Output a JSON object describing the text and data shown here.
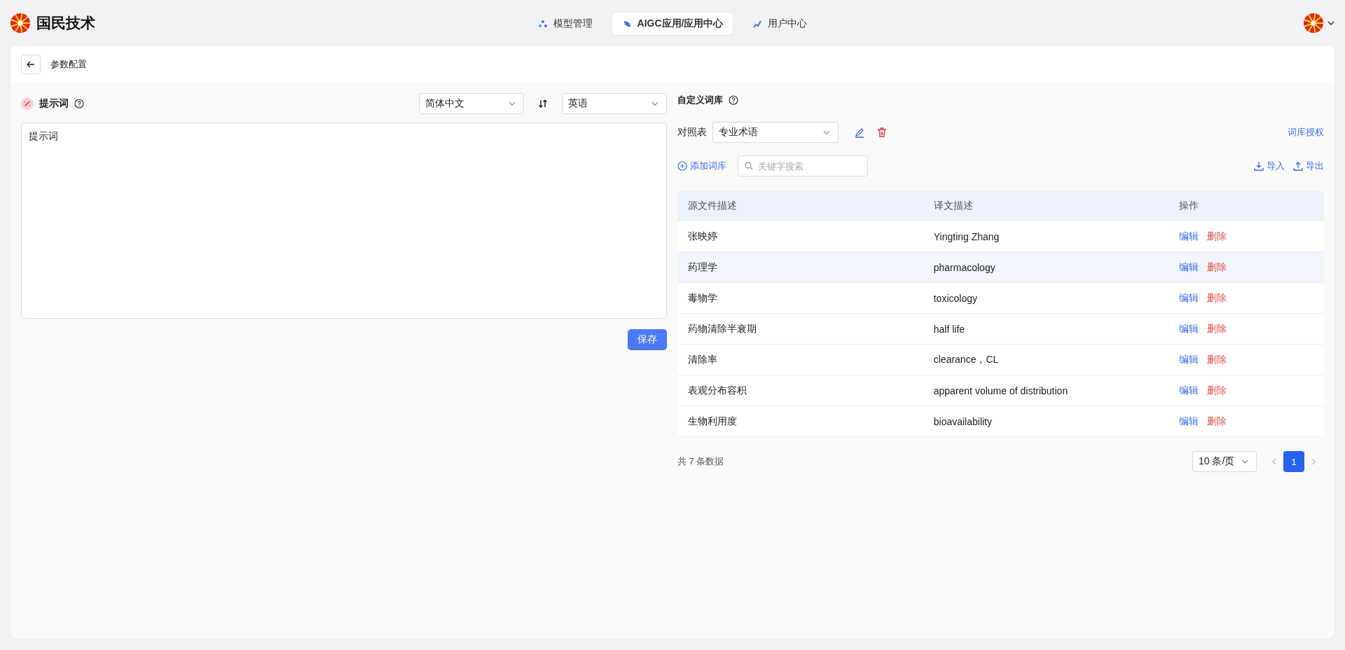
{
  "app": {
    "brand": "国民技术",
    "nav": [
      {
        "label": "模型管理",
        "selected": false
      },
      {
        "label": "AIGC应用/应用中心",
        "selected": true
      },
      {
        "label": "用户中心",
        "selected": false
      }
    ]
  },
  "page": {
    "title": "参数配置"
  },
  "prompt": {
    "label": "提示词",
    "source_language": "简体中文",
    "target_language": "英语",
    "value": "提示词",
    "save": "保存"
  },
  "glossary": {
    "title": "自定义词库",
    "table_label": "对照表",
    "selected_table": "专业术语",
    "authorize": "词库授权",
    "add": "添加词库",
    "search_placeholder": "关键字搜索",
    "import": "导入",
    "export": "导出",
    "columns": [
      "源文件描述",
      "译文描述",
      "操作"
    ],
    "rows": [
      {
        "source": "张映婷",
        "target": "Yingting Zhang",
        "edit": "编辑",
        "delete": "删除",
        "hovered": false
      },
      {
        "source": "药理学",
        "target": "pharmacology",
        "edit": "编辑",
        "delete": "删除",
        "hovered": true
      },
      {
        "source": "毒物学",
        "target": "toxicology",
        "edit": "编辑",
        "delete": "删除",
        "hovered": false
      },
      {
        "source": "药物清除半衰期",
        "target": "half life",
        "edit": "编辑",
        "delete": "删除",
        "hovered": false
      },
      {
        "source": "清除率",
        "target": "clearance，CL",
        "edit": "编辑",
        "delete": "删除",
        "hovered": false
      },
      {
        "source": "表观分布容积",
        "target": "apparent volume of distribution",
        "edit": "编辑",
        "delete": "删除",
        "hovered": false
      },
      {
        "source": "生物利用度",
        "target": "bioavailability",
        "edit": "编辑",
        "delete": "删除",
        "hovered": false
      }
    ],
    "total": "共 7 条数据",
    "page_size": "10 条/页",
    "pages": [
      {
        "label": "1",
        "selected": true
      }
    ]
  }
}
